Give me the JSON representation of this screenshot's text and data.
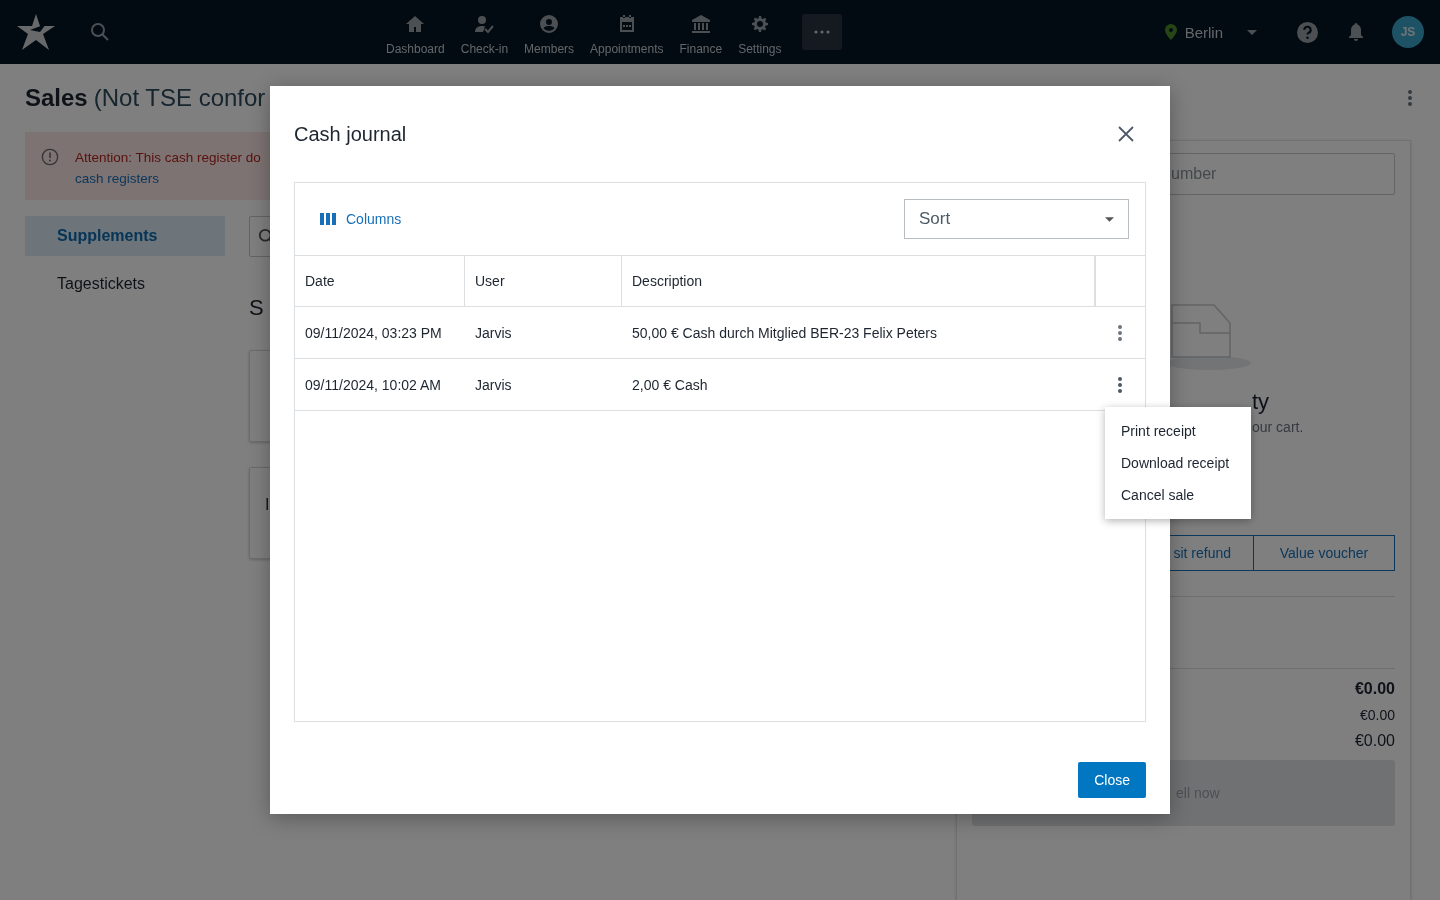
{
  "navbar": {
    "items": [
      {
        "label": "Dashboard"
      },
      {
        "label": "Check-in"
      },
      {
        "label": "Members"
      },
      {
        "label": "Appointments"
      },
      {
        "label": "Finance"
      },
      {
        "label": "Settings"
      }
    ],
    "location": "Berlin",
    "avatar": "JS"
  },
  "page": {
    "title": "Sales",
    "subtitle": "(Not TSE confor",
    "alert": {
      "text": "Attention: This cash register do",
      "link": "cash registers"
    },
    "categories": [
      {
        "label": "Supplements",
        "selected": true
      },
      {
        "label": "Tagestickets",
        "selected": false
      }
    ],
    "section_title": "S",
    "product_cards": [
      {
        "kind": "covered"
      },
      {
        "kind": "titled",
        "title": "I"
      }
    ],
    "cart": {
      "search_placeholder": "umber",
      "empty_title": "ty",
      "empty_hint": "our cart.",
      "buttons": [
        "sit refund",
        "Value voucher"
      ],
      "totals": [
        {
          "value": "€0.00",
          "kind": "grand"
        },
        {
          "value": "€0.00",
          "kind": "minor"
        },
        {
          "value": "€0.00",
          "kind": "normal"
        }
      ],
      "sell_button": "ell now"
    }
  },
  "dialog": {
    "title": "Cash journal",
    "columns_button": "Columns",
    "sort": {
      "placeholder": "Sort"
    },
    "table": {
      "columns": [
        "Date",
        "User",
        "Description"
      ],
      "rows": [
        {
          "date": "09/11/2024, 03:23 PM",
          "user": "Jarvis",
          "description": "50,00 € Cash durch Mitglied BER-23 Felix Peters",
          "menu_open": false
        },
        {
          "date": "09/11/2024, 10:02 AM",
          "user": "Jarvis",
          "description": "2,00 € Cash",
          "menu_open": true
        }
      ]
    },
    "row_menu": [
      "Print receipt",
      "Download receipt",
      "Cancel sale"
    ],
    "close_button": "Close"
  }
}
